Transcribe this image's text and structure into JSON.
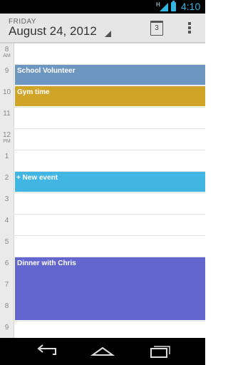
{
  "status_bar": {
    "network": "H",
    "time": "4:10",
    "colors": {
      "accent": "#33b5e5"
    }
  },
  "header": {
    "day": "FRIDAY",
    "date": "August 24, 2012",
    "today_number": "3"
  },
  "hours": [
    {
      "hour": "8",
      "ampm": "AM"
    },
    {
      "hour": "9",
      "ampm": ""
    },
    {
      "hour": "10",
      "ampm": ""
    },
    {
      "hour": "11",
      "ampm": ""
    },
    {
      "hour": "12",
      "ampm": "PM"
    },
    {
      "hour": "1",
      "ampm": ""
    },
    {
      "hour": "2",
      "ampm": ""
    },
    {
      "hour": "3",
      "ampm": ""
    },
    {
      "hour": "4",
      "ampm": ""
    },
    {
      "hour": "5",
      "ampm": ""
    },
    {
      "hour": "6",
      "ampm": ""
    },
    {
      "hour": "7",
      "ampm": ""
    },
    {
      "hour": "8",
      "ampm": ""
    },
    {
      "hour": "9",
      "ampm": ""
    }
  ],
  "events": [
    {
      "title": "School Volunteer",
      "color": "#6d96c1"
    },
    {
      "title": "Gym time",
      "color": "#cfa427"
    },
    {
      "title": "Dinner with Chris",
      "color": "#6466cf"
    }
  ],
  "new_event": {
    "label": "+ New event",
    "color": "#42b6e3"
  },
  "nav": {
    "icons": [
      "back-icon",
      "home-icon",
      "recent-apps-icon"
    ]
  }
}
